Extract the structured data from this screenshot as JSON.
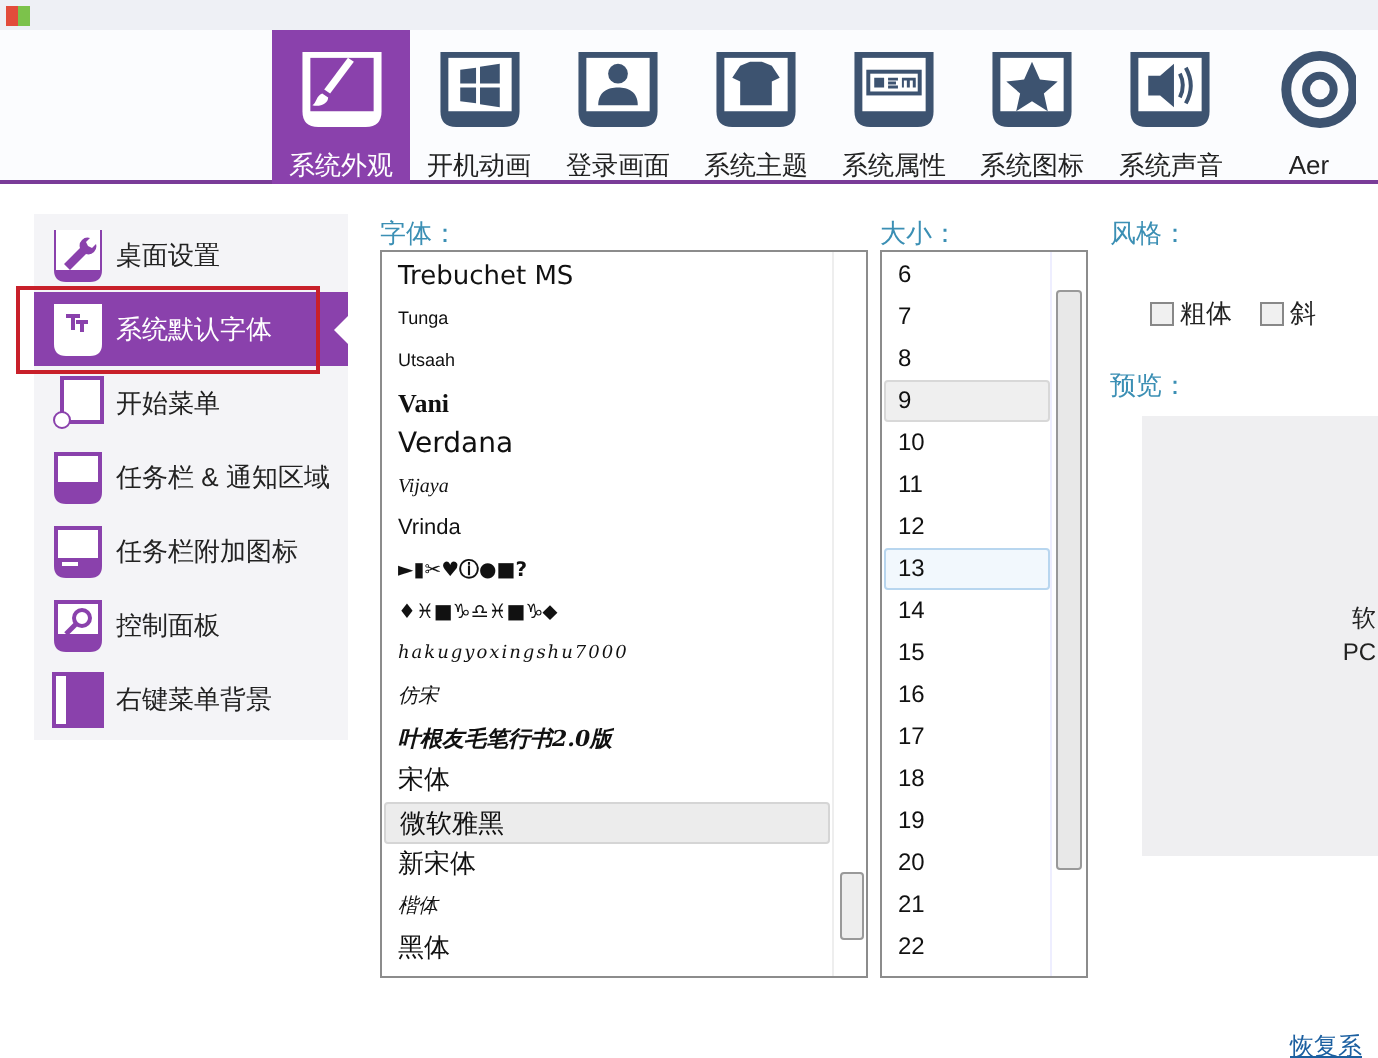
{
  "toolbar": {
    "tabs": [
      {
        "label": "系统外观",
        "kind": "brush",
        "selected": true
      },
      {
        "label": "开机动画",
        "kind": "windows",
        "selected": false
      },
      {
        "label": "登录画面",
        "kind": "user",
        "selected": false
      },
      {
        "label": "系统主题",
        "kind": "shirt",
        "selected": false
      },
      {
        "label": "系统属性",
        "kind": "oem",
        "selected": false
      },
      {
        "label": "系统图标",
        "kind": "star",
        "selected": false
      },
      {
        "label": "系统声音",
        "kind": "speaker",
        "selected": false
      },
      {
        "label": "Aer",
        "kind": "ring",
        "selected": false
      }
    ]
  },
  "sidebar": {
    "items": [
      {
        "label": "桌面设置",
        "kind": "wrench",
        "selected": false,
        "annotated": false
      },
      {
        "label": "系统默认字体",
        "kind": "tt",
        "selected": true,
        "annotated": true
      },
      {
        "label": "开始菜单",
        "kind": "start",
        "selected": false,
        "annotated": false
      },
      {
        "label": "任务栏 & 通知区域",
        "kind": "taskbar",
        "selected": false,
        "annotated": false
      },
      {
        "label": "任务栏附加图标",
        "kind": "taskicons",
        "selected": false,
        "annotated": false
      },
      {
        "label": "控制面板",
        "kind": "magnifier",
        "selected": false,
        "annotated": false
      },
      {
        "label": "右键菜单背景",
        "kind": "menubg",
        "selected": false,
        "annotated": false
      }
    ]
  },
  "font": {
    "label": "字体：",
    "items": [
      {
        "text": "Trebuchet MS",
        "kind": "large",
        "selected": false
      },
      {
        "text": "Tunga",
        "kind": "tiny",
        "selected": false
      },
      {
        "text": "Utsaah",
        "kind": "tiny",
        "selected": false
      },
      {
        "text": "Vani",
        "kind": "serif",
        "selected": false
      },
      {
        "text": "Verdana",
        "kind": "big",
        "selected": false
      },
      {
        "text": "Vijaya",
        "kind": "italic",
        "selected": false
      },
      {
        "text": "Vrinda",
        "kind": "normal",
        "selected": false
      },
      {
        "text": "►▮✂♥ⓘ●■?",
        "kind": "symbol",
        "selected": false
      },
      {
        "text": "♦♓■♑♎♓■♑⬥",
        "kind": "symbol",
        "selected": false
      },
      {
        "text": "hakugyoxingshu7000",
        "kind": "script",
        "selected": false
      },
      {
        "text": "仿宋",
        "kind": "italic",
        "selected": false
      },
      {
        "text": "叶根友毛笔行书2.0版",
        "kind": "brush",
        "selected": false
      },
      {
        "text": "宋体",
        "kind": "large",
        "selected": false
      },
      {
        "text": "微软雅黑",
        "kind": "large",
        "selected": true
      },
      {
        "text": "新宋体",
        "kind": "large",
        "selected": false
      },
      {
        "text": "楷体",
        "kind": "italic",
        "selected": false
      },
      {
        "text": "黑体",
        "kind": "large",
        "selected": false
      }
    ]
  },
  "size": {
    "label": "大小：",
    "items": [
      {
        "text": "6",
        "selected": false,
        "hovered": false
      },
      {
        "text": "7",
        "selected": false,
        "hovered": false
      },
      {
        "text": "8",
        "selected": false,
        "hovered": false
      },
      {
        "text": "9",
        "selected": false,
        "hovered": true
      },
      {
        "text": "10",
        "selected": false,
        "hovered": false
      },
      {
        "text": "11",
        "selected": false,
        "hovered": false
      },
      {
        "text": "12",
        "selected": false,
        "hovered": false
      },
      {
        "text": "13",
        "selected": true,
        "hovered": false
      },
      {
        "text": "14",
        "selected": false,
        "hovered": false
      },
      {
        "text": "15",
        "selected": false,
        "hovered": false
      },
      {
        "text": "16",
        "selected": false,
        "hovered": false
      },
      {
        "text": "17",
        "selected": false,
        "hovered": false
      },
      {
        "text": "18",
        "selected": false,
        "hovered": false
      },
      {
        "text": "19",
        "selected": false,
        "hovered": false
      },
      {
        "text": "20",
        "selected": false,
        "hovered": false
      },
      {
        "text": "21",
        "selected": false,
        "hovered": false
      },
      {
        "text": "22",
        "selected": false,
        "hovered": false
      }
    ]
  },
  "style": {
    "label": "风格：",
    "options": [
      {
        "label": "粗体",
        "checked": false
      },
      {
        "label": "斜",
        "checked": false
      }
    ]
  },
  "preview": {
    "label": "预览：",
    "lines": [
      "软",
      "PC"
    ]
  },
  "restore_link": "恢复系"
}
